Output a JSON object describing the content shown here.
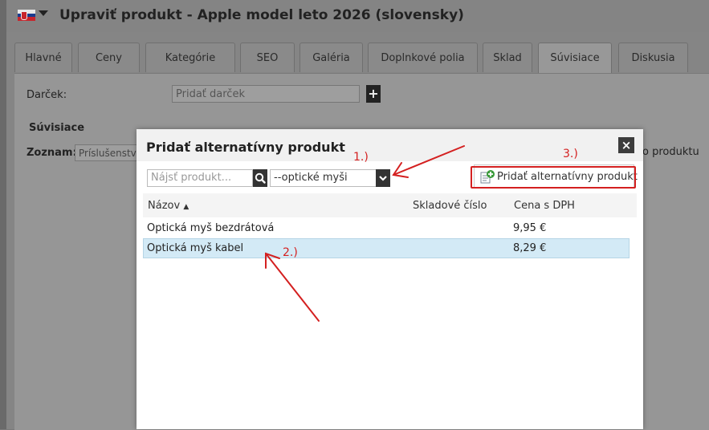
{
  "header": {
    "title": "Upraviť produkt - Apple model leto 2026 (slovensky)"
  },
  "tabs": [
    "Hlavné",
    "Ceny",
    "Kategórie",
    "SEO",
    "Galéria",
    "Doplnkové polia",
    "Sklad",
    "Súvisiace",
    "Diskusia"
  ],
  "active_tab": "Súvisiace",
  "form": {
    "gift_label": "Darček:",
    "gift_placeholder": "Pridať darček",
    "related_section": "Súvisiace",
    "list_label": "Zoznam:",
    "list_value": "Príslušenstvo",
    "right_text": "o produktu"
  },
  "modal": {
    "title": "Pridať alternatívny produkt",
    "search_placeholder": "Nájsť produkt...",
    "category_value": "--optické myši",
    "add_button_label": "Pridať alternatívny produkt",
    "columns": [
      "Názov",
      "Skladové číslo",
      "Cena s DPH"
    ],
    "rows": [
      {
        "name": "Optická myš bezdrátová",
        "sku": "",
        "price": "9,95 €"
      },
      {
        "name": "Optická myš kabel",
        "sku": "",
        "price": "8,29 €"
      }
    ]
  },
  "annotations": {
    "step1": "1.)",
    "step2": "2.)",
    "step3": "3.)",
    "color": "#d42020"
  }
}
